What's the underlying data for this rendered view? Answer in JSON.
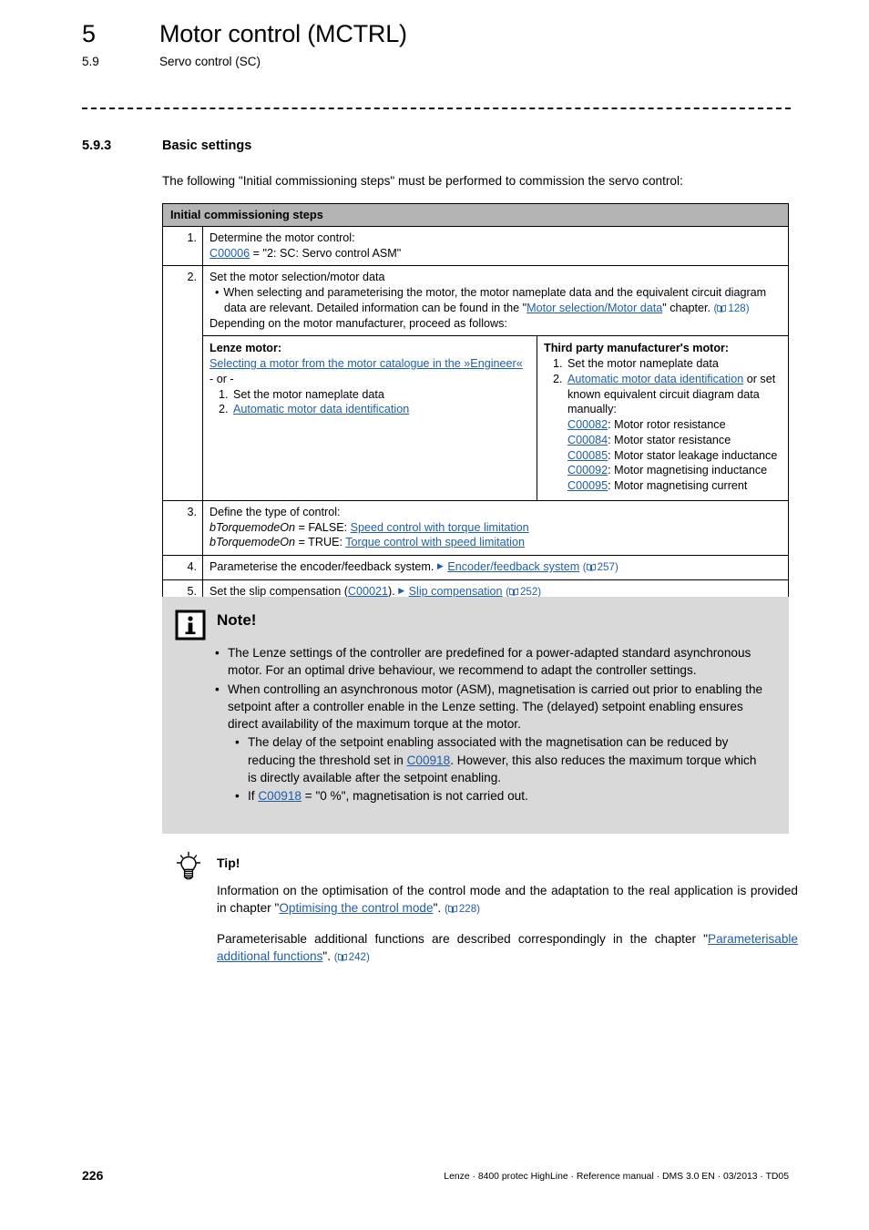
{
  "header": {
    "chapter_number": "5",
    "chapter_title": "Motor control (MCTRL)",
    "section_number": "5.9",
    "section_title": "Servo control (SC)"
  },
  "section": {
    "number": "5.9.3",
    "title": "Basic settings",
    "intro": "The following \"Initial commissioning steps\" must be performed to commission the servo control:"
  },
  "table": {
    "header": "Initial commissioning steps",
    "row1": {
      "num": "1.",
      "line1": "Determine the motor control:",
      "link": "C00006",
      "line2_rest": " = \"2: SC: Servo control ASM\""
    },
    "row2": {
      "num": "2.",
      "line1": "Set the motor selection/motor data",
      "bullet_a": "When selecting and parameterising the motor, the motor nameplate data and the equivalent circuit diagram data are relevant. Detailed information can be found in the \"",
      "bullet_a_link": "Motor selection/Motor data",
      "bullet_a_tail": "\" chapter. ",
      "bullet_a_page": "128",
      "line3": "Depending on the motor manufacturer, proceed as follows:",
      "left": {
        "title": "Lenze motor:",
        "link": "Selecting a motor from the motor catalogue in the »Engineer«",
        "or": "- or -",
        "item1_num": "1.",
        "item1": "Set the motor nameplate data",
        "item2_num": "2.",
        "item2_link": "Automatic motor data identification"
      },
      "right": {
        "title": "Third party manufacturer's motor:",
        "item1_num": "1.",
        "item1": "Set the motor nameplate data",
        "item2_num": "2.",
        "item2_link": "Automatic motor data identification",
        "item2_tail": " or set known equivalent circuit diagram data manually:",
        "params": [
          {
            "code": "C00082",
            "desc": ": Motor rotor resistance"
          },
          {
            "code": "C00084",
            "desc": ": Motor stator resistance"
          },
          {
            "code": "C00085",
            "desc": ": Motor stator leakage inductance"
          },
          {
            "code": "C00092",
            "desc": ": Motor magnetising inductance"
          },
          {
            "code": "C00095",
            "desc": ": Motor magnetising current"
          }
        ]
      }
    },
    "row3": {
      "num": "3.",
      "line1": "Define the type of control:",
      "var": "bTorquemodeOn",
      "false_label": " = FALSE: ",
      "false_link": "Speed control with torque limitation",
      "true_label": " = TRUE: ",
      "true_link": "Torque control with speed limitation"
    },
    "row4": {
      "num": "4.",
      "text": "Parameterise the encoder/feedback system. ",
      "link": "Encoder/feedback system",
      "page": "257"
    },
    "row5": {
      "num": "5.",
      "text_pre": "Set the slip compensation (",
      "code": "C00021",
      "text_mid": "). ",
      "link": "Slip compensation",
      "page": "252"
    }
  },
  "note": {
    "title": "Note!",
    "icon": "info-icon",
    "bullets": [
      "The Lenze settings of the controller are predefined for a power-adapted standard asynchronous motor. For an optimal drive behaviour, we recommend to adapt the controller settings.",
      "When controlling an asynchronous motor (ASM), magnetisation is carried out prior to enabling the setpoint after a controller enable in the Lenze setting. The (delayed) setpoint enabling ensures direct availability of the maximum torque at the motor."
    ],
    "sub1_pre": "The delay of the setpoint enabling associated with the magnetisation can be reduced by reducing the threshold set in ",
    "sub1_link": "C00918",
    "sub1_post": ". However, this also reduces the maximum torque which is directly available after the setpoint enabling.",
    "sub2_pre": "If ",
    "sub2_link": "C00918",
    "sub2_post": " = \"0 %\", magnetisation is not carried out."
  },
  "tip": {
    "title": "Tip!",
    "icon": "lightbulb-icon",
    "p1_pre": "Information on the optimisation of the control mode and the adaptation to the real application is provided in chapter \"",
    "p1_link": "Optimising the control mode",
    "p1_post": "\". ",
    "p1_page": "228",
    "p2_pre": "Parameterisable additional functions are described correspondingly in the chapter \"",
    "p2_link": "Parameterisable additional functions",
    "p2_post": "\". ",
    "p2_page": "242"
  },
  "footer": {
    "page_number": "226",
    "text": "Lenze · 8400 protec HighLine · Reference manual · DMS 3.0 EN · 03/2013 · TD05"
  },
  "colors": {
    "link": "#1f5fa9",
    "table_header_bg": "#b4b4b4",
    "note_bg": "#d9d9d9"
  }
}
